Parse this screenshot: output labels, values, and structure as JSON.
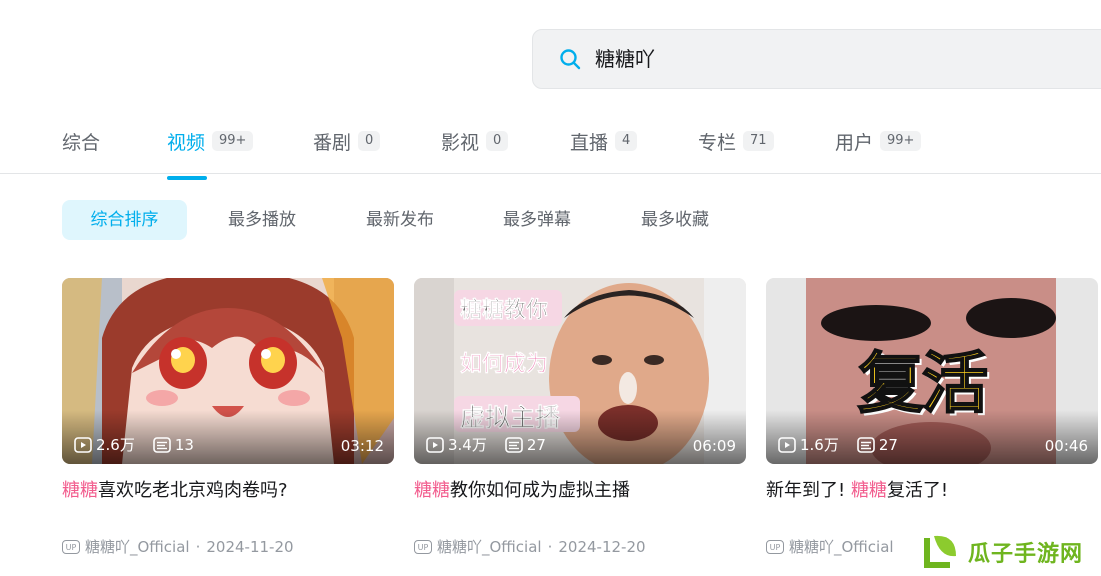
{
  "search": {
    "query": "糖糖吖"
  },
  "tabs": [
    {
      "label": "综合",
      "count": ""
    },
    {
      "label": "视频",
      "count": "99+"
    },
    {
      "label": "番剧",
      "count": "0"
    },
    {
      "label": "影视",
      "count": "0"
    },
    {
      "label": "直播",
      "count": "4"
    },
    {
      "label": "专栏",
      "count": "71"
    },
    {
      "label": "用户",
      "count": "99+"
    }
  ],
  "active_tab": "视频",
  "sort_options": [
    "综合排序",
    "最多播放",
    "最新发布",
    "最多弹幕",
    "最多收藏"
  ],
  "active_sort": "综合排序",
  "videos": [
    {
      "plays": "2.6万",
      "danmaku": "13",
      "duration": "03:12",
      "title_prefix": "",
      "title_highlight": "糖糖",
      "title_suffix": "喜欢吃老北京鸡肉卷吗?",
      "up_badge": "UP",
      "author": "糖糖吖_Official",
      "date": "2024-11-20"
    },
    {
      "plays": "3.4万",
      "danmaku": "27",
      "duration": "06:09",
      "title_prefix": "",
      "title_highlight": "糖糖",
      "title_suffix": "教你如何成为虚拟主播",
      "up_badge": "UP",
      "author": "糖糖吖_Official",
      "date": "2024-12-20",
      "thumb_text": [
        "糖糖教你",
        "如何成为",
        "虚拟主播"
      ]
    },
    {
      "plays": "1.6万",
      "danmaku": "27",
      "duration": "00:46",
      "title_prefix": "新年到了! ",
      "title_highlight": "糖糖",
      "title_suffix": "复活了!",
      "up_badge": "UP",
      "author": "糖糖吖_Official",
      "thumb_text": [
        "复活"
      ]
    }
  ],
  "meta_separator": "·",
  "watermark": {
    "text": "瓜子手游网"
  },
  "colors": {
    "accent": "#00aeec",
    "highlight": "#f25d8e",
    "muted": "#9499a0",
    "watermark": "#6fb51f"
  },
  "icons": {
    "search": "search-icon",
    "play": "play-icon",
    "danmaku": "danmaku-icon"
  }
}
